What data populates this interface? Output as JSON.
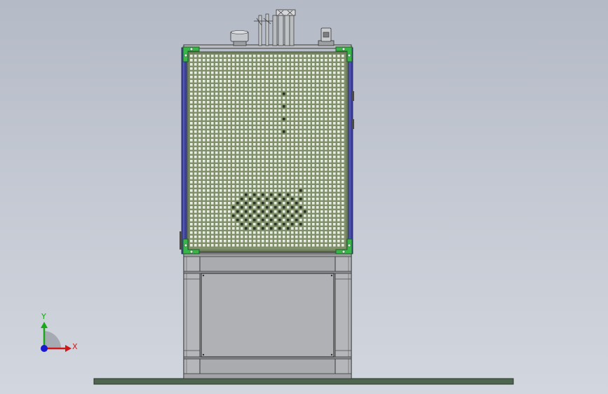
{
  "triad": {
    "x_label": "X",
    "y_label": "Y",
    "x_color": "#d01818",
    "y_color": "#18a818",
    "z_color": "#1818d0"
  },
  "colors": {
    "panel_fill": "#80906a",
    "panel_hole": "#e9ece2",
    "panel_frame": "#4a5a3e",
    "corner_bracket": "#39b54a",
    "side_trim": "#3b3f9a",
    "cabinet_steel": "#a9abae",
    "cabinet_edge": "#3a3a3a",
    "ground_plate": "#4e6550"
  },
  "icons": {
    "triad": "coordinate-triad-icon"
  }
}
